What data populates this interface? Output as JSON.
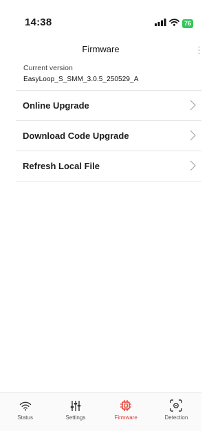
{
  "status_bar": {
    "time": "14:38",
    "battery": "76"
  },
  "header": {
    "title": "Firmware"
  },
  "version": {
    "label": "Current version",
    "value": "EasyLoop_S_SMM_3.0.5_250529_A"
  },
  "menu": {
    "items": [
      {
        "label": "Online Upgrade"
      },
      {
        "label": "Download Code Upgrade"
      },
      {
        "label": "Refresh Local File"
      }
    ]
  },
  "tab_bar": {
    "tabs": [
      {
        "label": "Status",
        "icon": "wifi-icon"
      },
      {
        "label": "Settings",
        "icon": "sliders-icon"
      },
      {
        "label": "Firmware",
        "icon": "chip-icon"
      },
      {
        "label": "Detection",
        "icon": "detection-icon"
      }
    ],
    "active_color": "#e2372b",
    "inactive_color": "#555555"
  }
}
